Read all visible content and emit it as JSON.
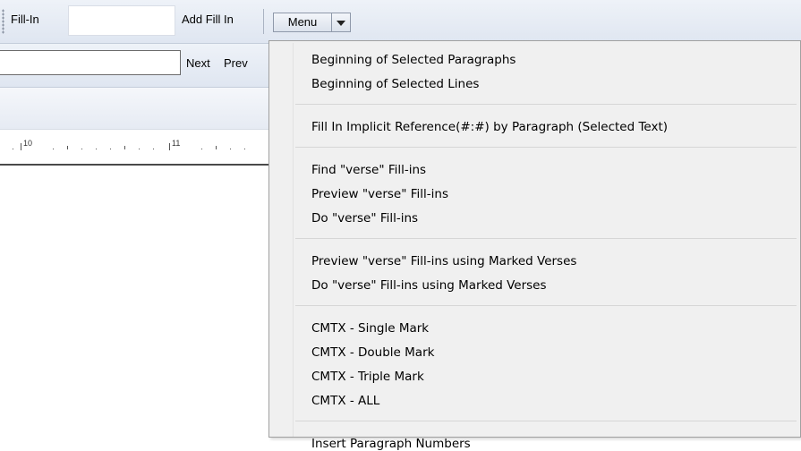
{
  "toolbar": {
    "fill_in_label": "Fill-In",
    "fill_in_value": "",
    "add_fill_in_label": "Add Fill In",
    "menu_label": "Menu"
  },
  "find_bar": {
    "search_value": "",
    "next_label": "Next",
    "prev_label": "Prev"
  },
  "ruler": {
    "label_10": "10",
    "label_11": "11"
  },
  "menu": {
    "groups": [
      [
        "Beginning of Selected Paragraphs",
        "Beginning of Selected Lines"
      ],
      [
        "Fill In Implicit Reference(#:#) by Paragraph (Selected Text)"
      ],
      [
        "Find \"verse\" Fill-ins",
        "Preview \"verse\" Fill-ins",
        "Do \"verse\" Fill-ins"
      ],
      [
        "Preview \"verse\" Fill-ins using Marked Verses",
        "Do \"verse\" Fill-ins using Marked Verses"
      ],
      [
        "CMTX - Single Mark",
        "CMTX - Double Mark",
        "CMTX - Triple Mark",
        "CMTX - ALL"
      ],
      [
        "Insert Paragraph Numbers"
      ]
    ]
  }
}
